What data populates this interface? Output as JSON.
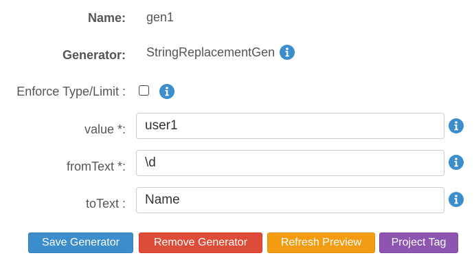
{
  "name": {
    "label": "Name:",
    "value": "gen1"
  },
  "generator": {
    "label": "Generator:",
    "value": "StringReplacementGen",
    "icon": "info-icon"
  },
  "enforce": {
    "label": "Enforce Type/Limit :",
    "checked": false,
    "icon": "info-icon"
  },
  "fields": {
    "value": {
      "label": "value *:",
      "input_value": "user1",
      "icon": "info-icon"
    },
    "fromText": {
      "label": "fromText *:",
      "input_value": "\\d",
      "icon": "info-icon"
    },
    "toText": {
      "label": "toText :",
      "input_value": "Name",
      "icon": "info-icon"
    }
  },
  "buttons": {
    "save": "Save Generator",
    "remove": "Remove Generator",
    "refresh": "Refresh Preview",
    "tag": "Project Tag"
  },
  "colors": {
    "info_icon": "#3c8dcb",
    "save": "#3c8dcb",
    "remove": "#dd4b39",
    "refresh": "#f39c12",
    "tag": "#8e55b0"
  }
}
